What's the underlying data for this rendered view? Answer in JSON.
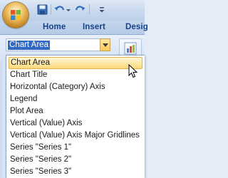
{
  "ribbon": {
    "tabs": [
      "Home",
      "Insert",
      "Desig"
    ]
  },
  "chart_element_selector": {
    "selected": "Chart Area",
    "options": [
      "Chart Area",
      "Chart Title",
      "Horizontal (Category) Axis",
      "Legend",
      "Plot Area",
      "Vertical (Value) Axis",
      "Vertical (Value) Axis Major Gridlines",
      "Series \"Series 1\"",
      "Series \"Series 2\"",
      "Series \"Series 3\""
    ],
    "hovered_index": 0
  },
  "colors": {
    "accent": "#15428b",
    "highlight": "#ffd97a",
    "selection": "#316ac5"
  }
}
